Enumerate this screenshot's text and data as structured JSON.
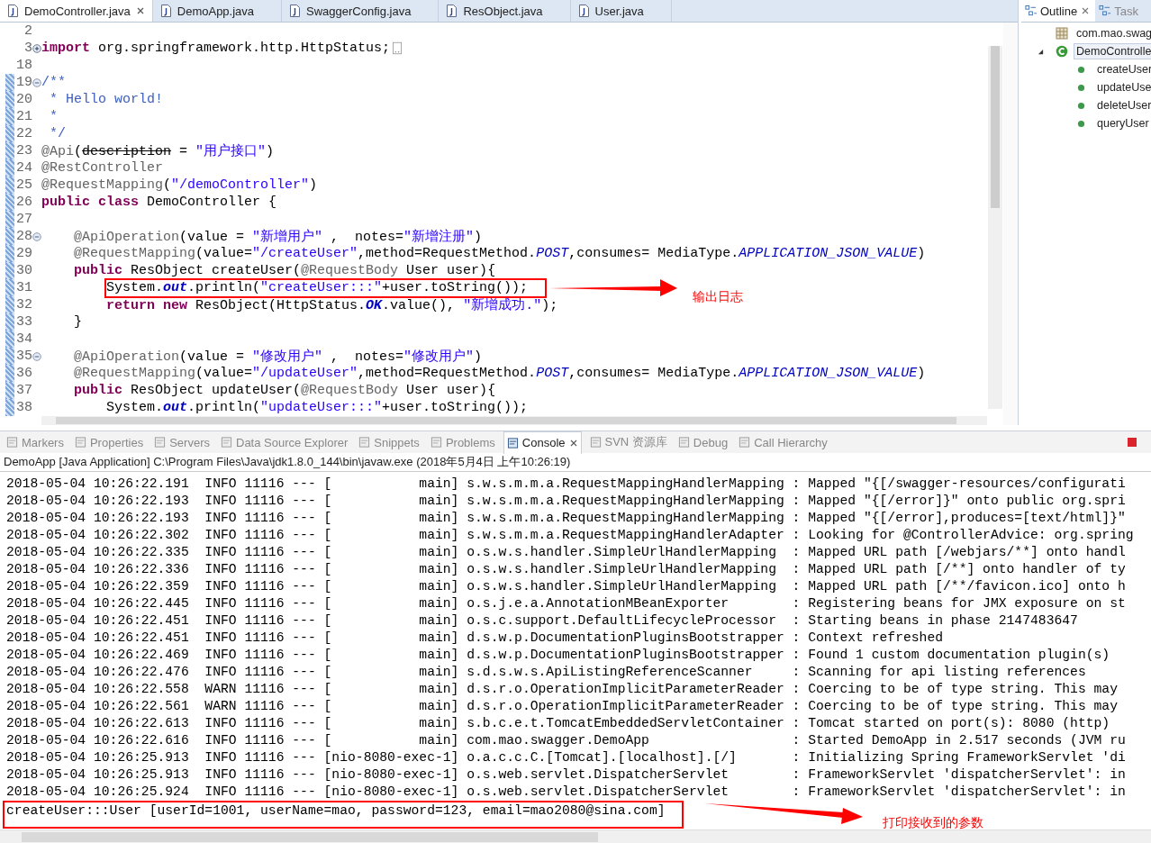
{
  "editor": {
    "tabs": [
      {
        "label": "DemoController.java",
        "selected": true,
        "closable": true
      },
      {
        "label": "DemoApp.java",
        "selected": false,
        "closable": false
      },
      {
        "label": "SwaggerConfig.java",
        "selected": false,
        "closable": false
      },
      {
        "label": "ResObject.java",
        "selected": false,
        "closable": false
      },
      {
        "label": "User.java",
        "selected": false,
        "closable": false
      }
    ],
    "lines": [
      {
        "number": "2",
        "changed": false
      },
      {
        "number": "3",
        "changed": false,
        "folded": true,
        "tokens": [
          {
            "kind": "kw",
            "text": "import"
          },
          {
            "kind": "txt",
            "text": " org.springframework.http.HttpStatus;"
          }
        ]
      },
      {
        "number": "18",
        "changed": false
      },
      {
        "number": "19",
        "changed": true,
        "folded": false,
        "tokens": [
          {
            "kind": "doc",
            "text": "/**"
          }
        ]
      },
      {
        "number": "20",
        "changed": true,
        "tokens": [
          {
            "kind": "doc",
            "text": " * Hello world!"
          }
        ]
      },
      {
        "number": "21",
        "changed": true,
        "tokens": [
          {
            "kind": "doc",
            "text": " *"
          }
        ]
      },
      {
        "number": "22",
        "changed": true,
        "tokens": [
          {
            "kind": "doc",
            "text": " */"
          }
        ]
      },
      {
        "number": "23",
        "changed": true,
        "tokens": [
          {
            "kind": "ann",
            "text": "@Api"
          },
          {
            "kind": "txt",
            "text": "("
          },
          {
            "kind": "dep",
            "text": "description"
          },
          {
            "kind": "txt",
            "text": " = "
          },
          {
            "kind": "str",
            "text": "\"用户接口\""
          },
          {
            "kind": "txt",
            "text": ")"
          }
        ]
      },
      {
        "number": "24",
        "changed": true,
        "tokens": [
          {
            "kind": "ann",
            "text": "@RestController"
          }
        ]
      },
      {
        "number": "25",
        "changed": true,
        "tokens": [
          {
            "kind": "ann",
            "text": "@RequestMapping"
          },
          {
            "kind": "txt",
            "text": "("
          },
          {
            "kind": "str",
            "text": "\"/demoController\""
          },
          {
            "kind": "txt",
            "text": ")"
          }
        ]
      },
      {
        "number": "26",
        "changed": true,
        "tokens": [
          {
            "kind": "kw",
            "text": "public"
          },
          {
            "kind": "kw",
            "text": " class"
          },
          {
            "kind": "txt",
            "text": " DemoController {"
          }
        ]
      },
      {
        "number": "27",
        "changed": true
      },
      {
        "number": "28",
        "changed": true,
        "folded": false,
        "tokens": [
          {
            "kind": "ann",
            "text": "    @ApiOperation"
          },
          {
            "kind": "txt",
            "text": "(value = "
          },
          {
            "kind": "str",
            "text": "\"新增用户\""
          },
          {
            "kind": "txt",
            "text": " ,  notes="
          },
          {
            "kind": "str",
            "text": "\"新增注册\""
          },
          {
            "kind": "txt",
            "text": ")"
          }
        ]
      },
      {
        "number": "29",
        "changed": true,
        "tokens": [
          {
            "kind": "ann",
            "text": "    @RequestMapping"
          },
          {
            "kind": "txt",
            "text": "(value="
          },
          {
            "kind": "str",
            "text": "\"/createUser\""
          },
          {
            "kind": "txt",
            "text": ",method=RequestMethod."
          },
          {
            "kind": "const",
            "text": "POST"
          },
          {
            "kind": "txt",
            "text": ",consumes= MediaType."
          },
          {
            "kind": "const",
            "text": "APPLICATION_JSON_VALUE"
          },
          {
            "kind": "txt",
            "text": ")"
          }
        ]
      },
      {
        "number": "30",
        "changed": true,
        "tokens": [
          {
            "kind": "kw",
            "text": "    public"
          },
          {
            "kind": "txt",
            "text": " ResObject createUser("
          },
          {
            "kind": "ann",
            "text": "@RequestBody"
          },
          {
            "kind": "txt",
            "text": " User user){"
          }
        ]
      },
      {
        "number": "31",
        "changed": true,
        "highlighted": true,
        "tokens": [
          {
            "kind": "txt",
            "text": "        System."
          },
          {
            "kind": "field",
            "text": "out"
          },
          {
            "kind": "txt",
            "text": ".println("
          },
          {
            "kind": "str",
            "text": "\"createUser:::\""
          },
          {
            "kind": "txt",
            "text": "+user.toString());"
          }
        ]
      },
      {
        "number": "32",
        "changed": true,
        "tokens": [
          {
            "kind": "kw",
            "text": "        return"
          },
          {
            "kind": "kw",
            "text": " new"
          },
          {
            "kind": "txt",
            "text": " ResObject(HttpStatus."
          },
          {
            "kind": "field",
            "text": "OK"
          },
          {
            "kind": "txt",
            "text": ".value(), "
          },
          {
            "kind": "str",
            "text": "\"新增成功.\""
          },
          {
            "kind": "txt",
            "text": ");"
          }
        ]
      },
      {
        "number": "33",
        "changed": true,
        "tokens": [
          {
            "kind": "txt",
            "text": "    }"
          }
        ]
      },
      {
        "number": "34",
        "changed": true
      },
      {
        "number": "35",
        "changed": true,
        "folded": false,
        "tokens": [
          {
            "kind": "ann",
            "text": "    @ApiOperation"
          },
          {
            "kind": "txt",
            "text": "(value = "
          },
          {
            "kind": "str",
            "text": "\"修改用户\""
          },
          {
            "kind": "txt",
            "text": " ,  notes="
          },
          {
            "kind": "str",
            "text": "\"修改用户\""
          },
          {
            "kind": "txt",
            "text": ")"
          }
        ]
      },
      {
        "number": "36",
        "changed": true,
        "tokens": [
          {
            "kind": "ann",
            "text": "    @RequestMapping"
          },
          {
            "kind": "txt",
            "text": "(value="
          },
          {
            "kind": "str",
            "text": "\"/updateUser\""
          },
          {
            "kind": "txt",
            "text": ",method=RequestMethod."
          },
          {
            "kind": "const",
            "text": "POST"
          },
          {
            "kind": "txt",
            "text": ",consumes= MediaType."
          },
          {
            "kind": "const",
            "text": "APPLICATION_JSON_VALUE"
          },
          {
            "kind": "txt",
            "text": ")"
          }
        ]
      },
      {
        "number": "37",
        "changed": true,
        "tokens": [
          {
            "kind": "kw",
            "text": "    public"
          },
          {
            "kind": "txt",
            "text": " ResObject updateUser("
          },
          {
            "kind": "ann",
            "text": "@RequestBody"
          },
          {
            "kind": "txt",
            "text": " User user){"
          }
        ]
      },
      {
        "number": "38",
        "changed": true,
        "tokens": [
          {
            "kind": "txt",
            "text": "        System."
          },
          {
            "kind": "field",
            "text": "out"
          },
          {
            "kind": "txt",
            "text": ".println("
          },
          {
            "kind": "str",
            "text": "\"updateUser:::\""
          },
          {
            "kind": "txt",
            "text": "+user.toString());"
          }
        ]
      }
    ]
  },
  "outline": {
    "tabs": [
      {
        "label": "Outline",
        "selected": true,
        "closable": true
      },
      {
        "label": "Task",
        "selected": false,
        "closable": false
      }
    ],
    "items": [
      {
        "text": "com.mao.swag",
        "kind": "package",
        "selected": false
      },
      {
        "text": "DemoControlle",
        "kind": "class",
        "selected": true,
        "expanded": true,
        "children": [
          {
            "text": "createUser",
            "kind": "method",
            "selected": false
          },
          {
            "text": "updateUse",
            "kind": "method",
            "selected": false
          },
          {
            "text": "deleteUser",
            "kind": "method",
            "selected": false
          },
          {
            "text": "queryUser",
            "kind": "method",
            "selected": false
          }
        ]
      }
    ]
  },
  "console": {
    "tabs": [
      {
        "label": "Markers",
        "selected": false,
        "closable": false
      },
      {
        "label": "Properties",
        "selected": false,
        "closable": false
      },
      {
        "label": "Servers",
        "selected": false,
        "closable": false
      },
      {
        "label": "Data Source Explorer",
        "selected": false,
        "closable": false
      },
      {
        "label": "Snippets",
        "selected": false,
        "closable": false
      },
      {
        "label": "Problems",
        "selected": false,
        "closable": false
      },
      {
        "label": "Console",
        "selected": true,
        "closable": true
      },
      {
        "label": "SVN 资源库",
        "selected": false,
        "closable": false
      },
      {
        "label": "Debug",
        "selected": false,
        "closable": false
      },
      {
        "label": "Call Hierarchy",
        "selected": false,
        "closable": false
      }
    ],
    "launch": "DemoApp [Java Application] C:\\Program Files\\Java\\jdk1.8.0_144\\bin\\javaw.exe (2018年5月4日 上午10:26:19)",
    "lines": [
      "2018-05-04 10:26:22.191  INFO 11116 --- [           main] s.w.s.m.m.a.RequestMappingHandlerMapping : Mapped \"{[/swagger-resources/configurati",
      "2018-05-04 10:26:22.193  INFO 11116 --- [           main] s.w.s.m.m.a.RequestMappingHandlerMapping : Mapped \"{[/error]}\" onto public org.spri",
      "2018-05-04 10:26:22.193  INFO 11116 --- [           main] s.w.s.m.m.a.RequestMappingHandlerMapping : Mapped \"{[/error],produces=[text/html]}\"",
      "2018-05-04 10:26:22.302  INFO 11116 --- [           main] s.w.s.m.m.a.RequestMappingHandlerAdapter : Looking for @ControllerAdvice: org.spring",
      "2018-05-04 10:26:22.335  INFO 11116 --- [           main] o.s.w.s.handler.SimpleUrlHandlerMapping  : Mapped URL path [/webjars/**] onto handl",
      "2018-05-04 10:26:22.336  INFO 11116 --- [           main] o.s.w.s.handler.SimpleUrlHandlerMapping  : Mapped URL path [/**] onto handler of ty",
      "2018-05-04 10:26:22.359  INFO 11116 --- [           main] o.s.w.s.handler.SimpleUrlHandlerMapping  : Mapped URL path [/**/favicon.ico] onto h",
      "2018-05-04 10:26:22.445  INFO 11116 --- [           main] o.s.j.e.a.AnnotationMBeanExporter        : Registering beans for JMX exposure on st",
      "2018-05-04 10:26:22.451  INFO 11116 --- [           main] o.s.c.support.DefaultLifecycleProcessor  : Starting beans in phase 2147483647",
      "2018-05-04 10:26:22.451  INFO 11116 --- [           main] d.s.w.p.DocumentationPluginsBootstrapper : Context refreshed",
      "2018-05-04 10:26:22.469  INFO 11116 --- [           main] d.s.w.p.DocumentationPluginsBootstrapper : Found 1 custom documentation plugin(s)",
      "2018-05-04 10:26:22.476  INFO 11116 --- [           main] s.d.s.w.s.ApiListingReferenceScanner     : Scanning for api listing references",
      "2018-05-04 10:26:22.558  WARN 11116 --- [           main] d.s.r.o.OperationImplicitParameterReader : Coercing to be of type string. This may",
      "2018-05-04 10:26:22.561  WARN 11116 --- [           main] d.s.r.o.OperationImplicitParameterReader : Coercing to be of type string. This may",
      "2018-05-04 10:26:22.613  INFO 11116 --- [           main] s.b.c.e.t.TomcatEmbeddedServletContainer : Tomcat started on port(s): 8080 (http)",
      "2018-05-04 10:26:22.616  INFO 11116 --- [           main] com.mao.swagger.DemoApp                  : Started DemoApp in 2.517 seconds (JVM ru",
      "2018-05-04 10:26:25.913  INFO 11116 --- [nio-8080-exec-1] o.a.c.c.C.[Tomcat].[localhost].[/]       : Initializing Spring FrameworkServlet 'di",
      "2018-05-04 10:26:25.913  INFO 11116 --- [nio-8080-exec-1] o.s.web.servlet.DispatcherServlet        : FrameworkServlet 'dispatcherServlet': in",
      "2018-05-04 10:26:25.924  INFO 11116 --- [nio-8080-exec-1] o.s.web.servlet.DispatcherServlet        : FrameworkServlet 'dispatcherServlet': in"
    ],
    "output": {
      "text": "createUser:::User [userId=1001, userName=mao, password=123, email=mao2080@sina.com]",
      "highlighted": true
    }
  },
  "annotations": [
    {
      "text": "输出日志"
    },
    {
      "text": "打印接收到的参数"
    }
  ]
}
